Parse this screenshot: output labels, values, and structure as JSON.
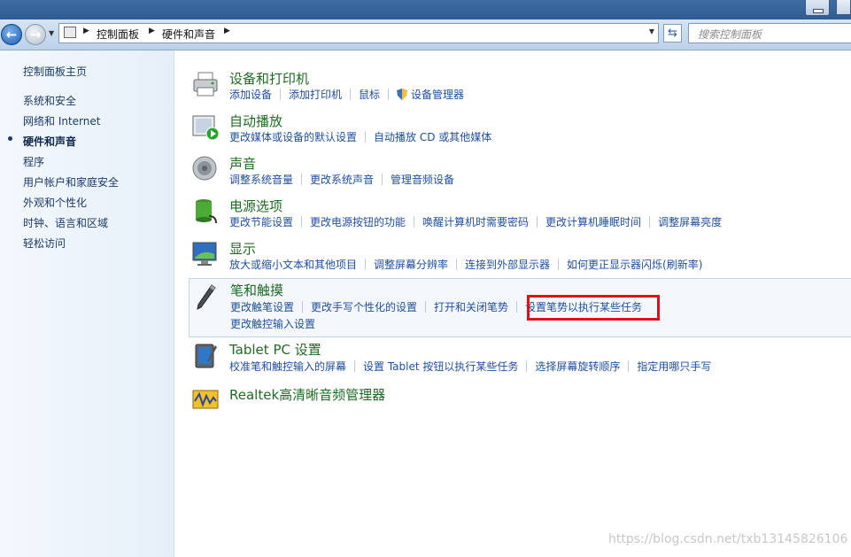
{
  "address": {
    "crumbs": [
      "控制面板",
      "硬件和声音"
    ],
    "search_placeholder": "搜索控制面板"
  },
  "sidebar": {
    "items": [
      {
        "label": "控制面板主页"
      },
      {
        "label": "系统和安全"
      },
      {
        "label": "网络和 Internet"
      },
      {
        "label": "硬件和声音",
        "active": true
      },
      {
        "label": "程序"
      },
      {
        "label": "用户帐户和家庭安全"
      },
      {
        "label": "外观和个性化"
      },
      {
        "label": "时钟、语言和区域"
      },
      {
        "label": "轻松访问"
      }
    ]
  },
  "categories": [
    {
      "title": "设备和打印机",
      "icon": "printer-icon",
      "links": [
        "添加设备",
        "添加打印机",
        "鼠标",
        "设备管理器"
      ]
    },
    {
      "title": "自动播放",
      "icon": "autoplay-icon",
      "links": [
        "更改媒体或设备的默认设置",
        "自动播放 CD 或其他媒体"
      ]
    },
    {
      "title": "声音",
      "icon": "speaker-icon",
      "links": [
        "调整系统音量",
        "更改系统声音",
        "管理音频设备"
      ]
    },
    {
      "title": "电源选项",
      "icon": "battery-icon",
      "links": [
        "更改节能设置",
        "更改电源按钮的功能",
        "唤醒计算机时需要密码",
        "更改计算机睡眠时间",
        "调整屏幕亮度"
      ]
    },
    {
      "title": "显示",
      "icon": "monitor-icon",
      "links": [
        "放大或缩小文本和其他项目",
        "调整屏幕分辨率",
        "连接到外部显示器",
        "如何更正显示器闪烁(刷新率)"
      ]
    },
    {
      "title": "笔和触摸",
      "icon": "pen-icon",
      "links": [
        "更改触笔设置",
        "更改手写个性化的设置",
        "打开和关闭笔势",
        "设置笔势以执行某些任务"
      ],
      "links2": [
        "更改触控输入设置"
      ]
    },
    {
      "title": "Tablet PC 设置",
      "icon": "tablet-icon",
      "links": [
        "校准笔和触控输入的屏幕",
        "设置 Tablet 按钮以执行某些任务",
        "选择屏幕旋转顺序",
        "指定用哪只手写"
      ]
    },
    {
      "title": "Realtek高清晰音频管理器",
      "icon": "realtek-audio-icon",
      "links": []
    }
  ],
  "watermark": "https://blog.csdn.net/txb13145826106",
  "colors": {
    "highlight": "#e0101a",
    "link": "#1e4f9e",
    "title": "#1f6b23"
  }
}
